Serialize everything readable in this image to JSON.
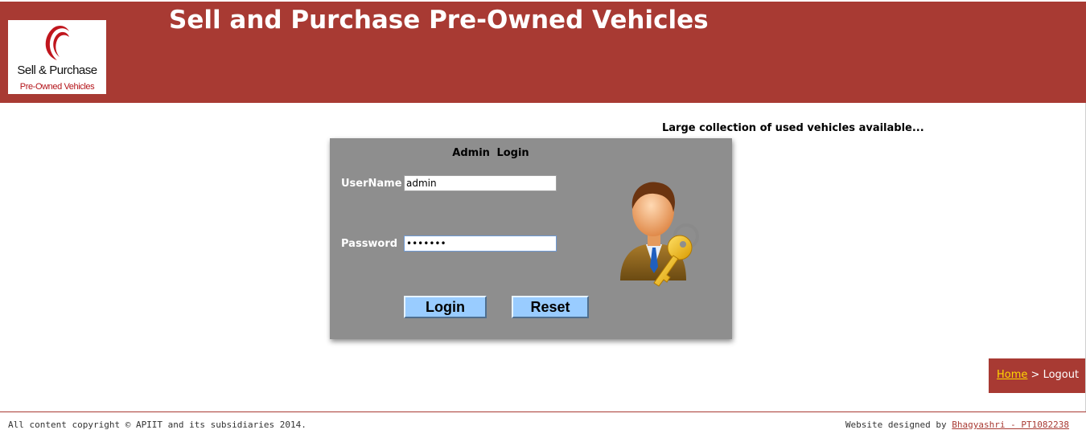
{
  "header": {
    "title": "Sell and Purchase Pre-Owned Vehicles",
    "logo": {
      "line1": "Sell & Purchase",
      "line2": "Pre-Owned Vehicles",
      "icon": "swirl-logo-icon"
    }
  },
  "tagline": "Large collection of used vehicles available...",
  "login": {
    "heading": "Admin  Login",
    "username_label": "UserName",
    "username_value": "admin",
    "password_label": "Password",
    "password_value": "•••••••",
    "login_button": "Login",
    "reset_button": "Reset",
    "avatar_icon": "admin-key-user-icon"
  },
  "breadcrumb": {
    "home": "Home",
    "separator": " > ",
    "current": "Logout"
  },
  "footer": {
    "copyright": "All content copyright © APIIT and its subsidiaries 2014.",
    "designed_by_prefix": "Website designed by ",
    "designer": "Bhagyashri - PT1082238"
  },
  "colors": {
    "brand": "#a83a33",
    "panel": "#8e8e8e",
    "button": "#99ccff",
    "link": "#ffd700"
  }
}
